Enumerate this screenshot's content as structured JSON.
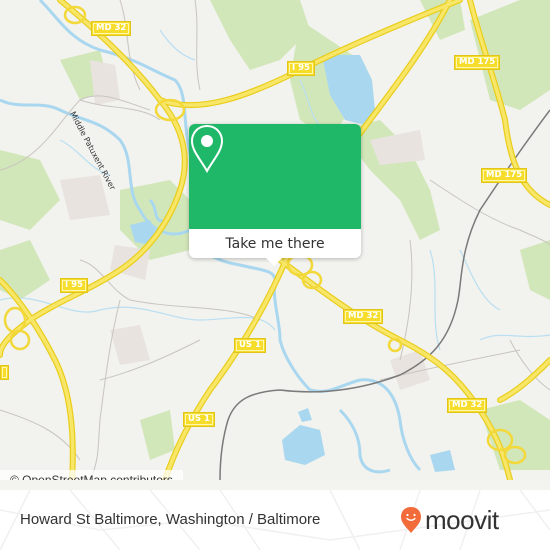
{
  "map": {
    "road_labels": [
      {
        "id": "md32-top",
        "text": "MD 32"
      },
      {
        "id": "i95-top",
        "text": "I 95"
      },
      {
        "id": "md175-top",
        "text": "MD 175"
      },
      {
        "id": "md175-mid",
        "text": "MD 175"
      },
      {
        "id": "i95-left",
        "text": "I 95"
      },
      {
        "id": "us1-mid",
        "text": "US 1"
      },
      {
        "id": "us1-low",
        "text": "US 1"
      },
      {
        "id": "md32-mid",
        "text": "MD 32"
      },
      {
        "id": "md32-right",
        "text": "MD 32"
      }
    ],
    "river_label": "Middle Patuxent River",
    "colors": {
      "land": "#f2f2ee",
      "park": "#cfe6b4",
      "water": "#a9d7ef",
      "road": "#f6dd2c",
      "urban": "#e8e2de"
    }
  },
  "popup": {
    "icon": "map-pin-icon",
    "button_label": "Take me there",
    "accent_color": "#1fb868"
  },
  "attribution": "© OpenStreetMap contributors",
  "footer": {
    "location_title": "Howard St Baltimore, Washington / Baltimore",
    "brand_name": "moovit",
    "brand_color": "#f26b3a"
  }
}
